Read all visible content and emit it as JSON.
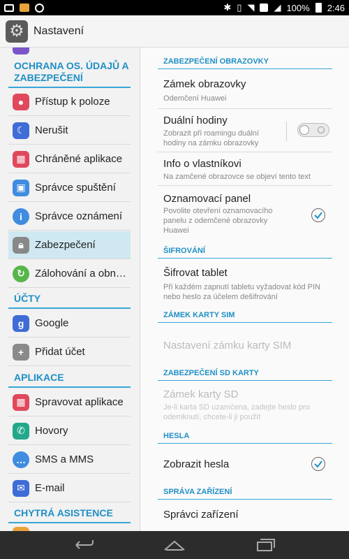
{
  "statusbar": {
    "battery": "100%",
    "time": "2:46"
  },
  "appbar": {
    "title": "Nastavení",
    "icon": "gear-icon"
  },
  "left": {
    "categories": [
      {
        "label": "OCHRANA OS. ÚDAJŮ A ZABEZPEČENÍ"
      },
      {
        "label": "ÚČTY"
      },
      {
        "label": "APLIKACE"
      },
      {
        "label": "CHYTRÁ ASISTENCE"
      }
    ],
    "items": [
      {
        "label": "Přístup k poloze",
        "icon": "location-pin-icon",
        "color": "#e0485b"
      },
      {
        "label": "Nerušit",
        "icon": "moon-icon",
        "color": "#3f6cd6"
      },
      {
        "label": "Chráněné aplikace",
        "icon": "protected-apps-icon",
        "color": "#e0485b"
      },
      {
        "label": "Správce spuštění",
        "icon": "startup-manager-icon",
        "color": "#3f8ce0"
      },
      {
        "label": "Správce oznámení",
        "icon": "info-icon",
        "color": "#3f8ce0"
      },
      {
        "label": "Zabezpečení",
        "icon": "lock-icon",
        "color": "#888888",
        "active": true
      },
      {
        "label": "Zálohování a obn…",
        "icon": "backup-icon",
        "color": "#56b648"
      },
      {
        "label": "Google",
        "icon": "google-icon",
        "color": "#3f6cd6"
      },
      {
        "label": "Přidat účet",
        "icon": "plus-icon",
        "color": "#8a8a8a"
      },
      {
        "label": "Spravovat aplikace",
        "icon": "manage-apps-icon",
        "color": "#e0485b"
      },
      {
        "label": "Hovory",
        "icon": "phone-icon",
        "color": "#22a88a"
      },
      {
        "label": "SMS a MMS",
        "icon": "message-icon",
        "color": "#3f8ce0"
      },
      {
        "label": "E-mail",
        "icon": "mail-icon",
        "color": "#3f6cd6"
      }
    ]
  },
  "right": {
    "sections": [
      {
        "label": "ZABEZPEČENÍ OBRAZOVKY"
      },
      {
        "label": "ŠIFROVÁNÍ"
      },
      {
        "label": "ZÁMEK KARTY SIM"
      },
      {
        "label": "ZABEZPEČENÍ SD KARTY"
      },
      {
        "label": "HESLA"
      },
      {
        "label": "SPRÁVA ZAŘÍZENÍ"
      }
    ],
    "items": [
      {
        "title": "Zámek obrazovky",
        "summary": "Odemčení Huawei"
      },
      {
        "title": "Duální hodiny",
        "summary": "Zobrazit při roamingu duální hodiny na zámku obrazovky",
        "toggle": false
      },
      {
        "title": "Info o vlastníkovi",
        "summary": "Na zamčené obrazovce se objeví tento text"
      },
      {
        "title": "Oznamovací panel",
        "summary": "Povolite otevření oznamovacího panelu z odemčené obrazovky Huawei",
        "checked": true
      },
      {
        "title": "Šifrovat tablet",
        "summary": "Při každém zapnutí tabletu vyžadovat kód PIN nebo heslo za účelem dešifrování"
      },
      {
        "title": "Nastavení zámku karty SIM",
        "disabled": true
      },
      {
        "title": "Zámek karty SD",
        "summary": "Je-li karta SD uzamčena, zadejte heslo pro odemknutí, chcete-li ji použít",
        "disabled": true
      },
      {
        "title": "Zobrazit hesla",
        "checked": true
      },
      {
        "title": "Správci zařízení"
      }
    ]
  }
}
